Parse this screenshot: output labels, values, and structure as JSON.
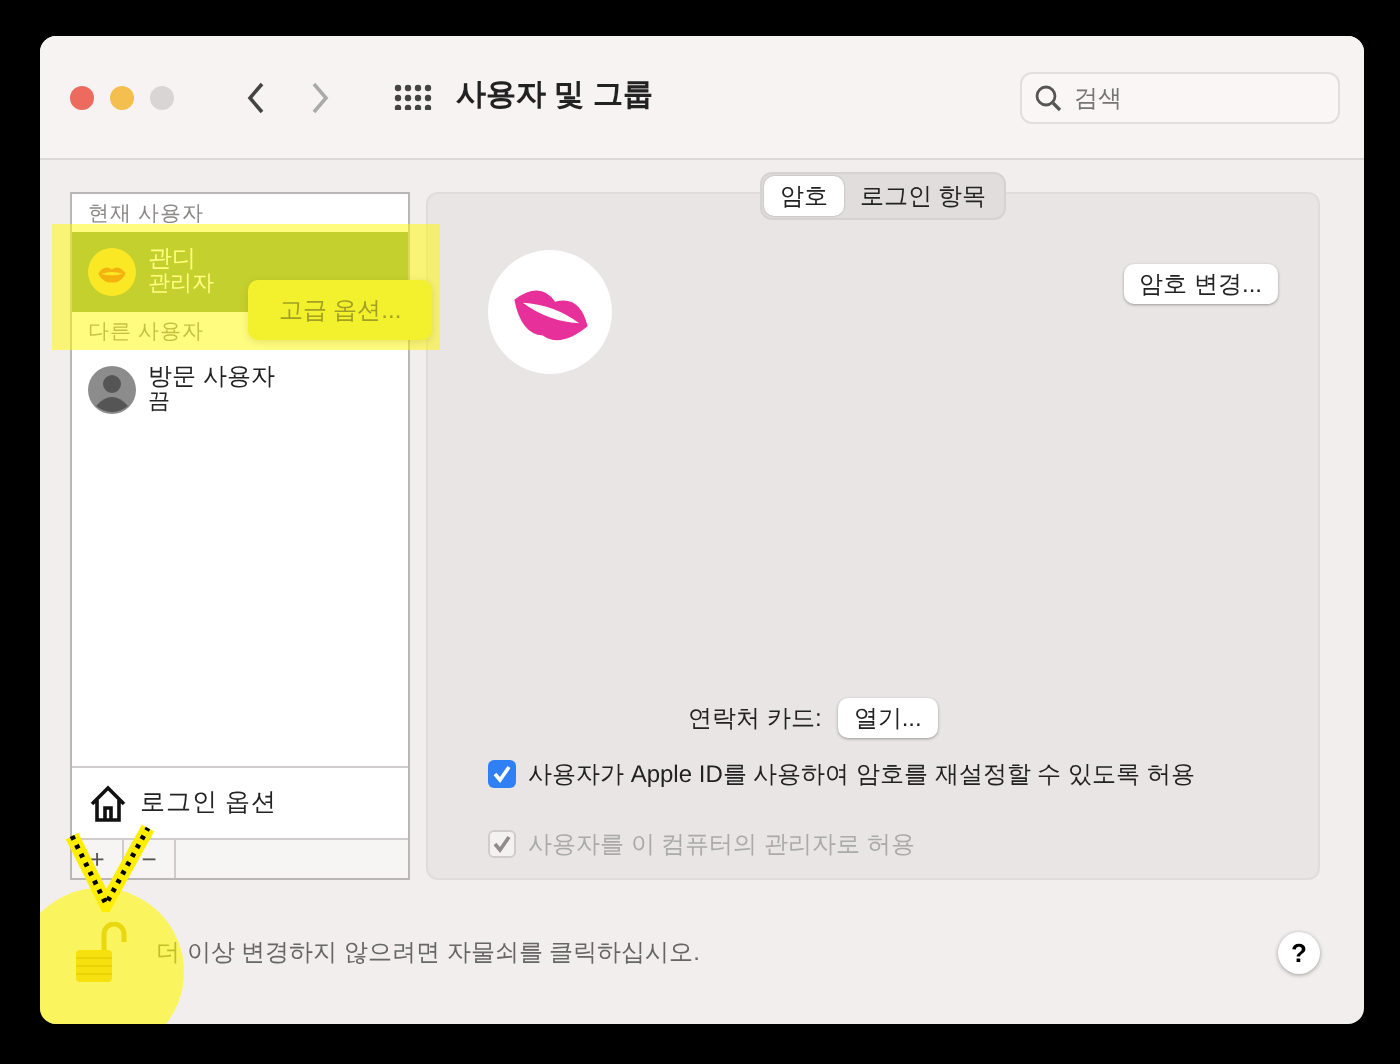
{
  "window": {
    "title": "사용자 및 그룹",
    "search": {
      "placeholder": "검색"
    }
  },
  "sidebar": {
    "sections": [
      {
        "header": "현재 사용자",
        "users": [
          {
            "name": "관디",
            "role": "관리자",
            "selected": true,
            "kind": "lips"
          }
        ]
      },
      {
        "header": "다른 사용자",
        "users": [
          {
            "name": "방문 사용자",
            "role": "끔",
            "selected": false,
            "kind": "person"
          }
        ]
      }
    ],
    "context_menu": {
      "item": "고급 옵션..."
    },
    "login_options": "로그인 옵션",
    "add": "+",
    "remove": "−"
  },
  "tabs": [
    {
      "label": "암호",
      "selected": true
    },
    {
      "label": "로그인 항목",
      "selected": false
    }
  ],
  "change_password_button": "암호 변경...",
  "contact_card": {
    "label": "연락처 카드:",
    "button": "열기..."
  },
  "options": [
    {
      "label": "사용자가 Apple ID를 사용하여 암호를 재설정할 수 있도록 허용",
      "checked": true,
      "disabled": false
    },
    {
      "label": "사용자를 이 컴퓨터의 관리자로 허용",
      "checked": true,
      "disabled": true
    }
  ],
  "lock": {
    "locked": false,
    "message": "더 이상 변경하지 않으려면 자물쇠를 클릭하십시오."
  },
  "help_button": "?",
  "annotations": [
    {
      "kind": "highlight-rect"
    },
    {
      "kind": "highlight-circle"
    },
    {
      "kind": "check-arrow"
    }
  ]
}
